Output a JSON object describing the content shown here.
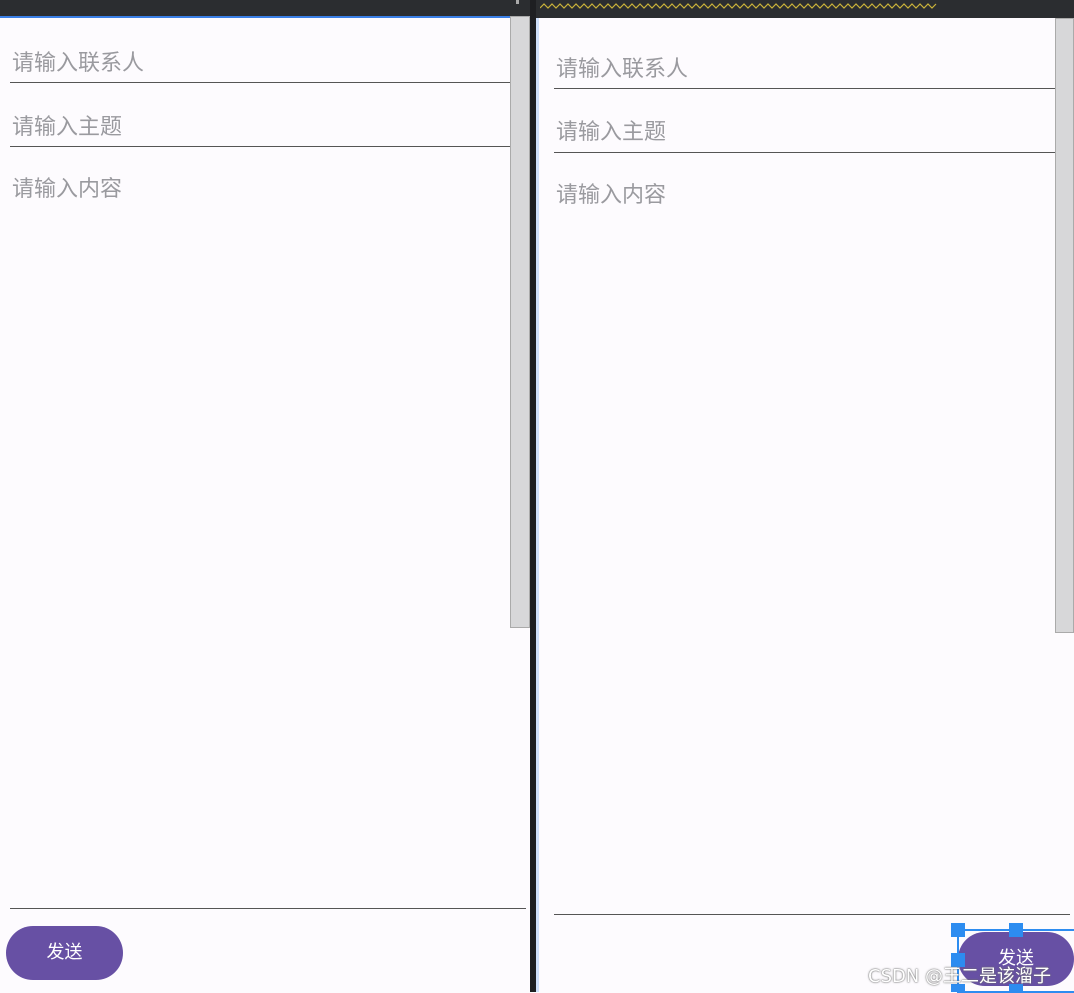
{
  "left_preview": {
    "contact_placeholder": "请输入联系人",
    "subject_placeholder": "请输入主题",
    "content_placeholder": "请输入内容",
    "send_label": "发送"
  },
  "right_preview": {
    "contact_placeholder": "请输入联系人",
    "subject_placeholder": "请输入主题",
    "content_placeholder": "请输入内容",
    "send_label": "发送"
  },
  "watermark": "CSDN @王二是该溜子",
  "colors": {
    "button": "#6750a4",
    "selection": "#2d8cf0",
    "background": "#fdfbfe",
    "placeholder": "#9a9a9f"
  }
}
